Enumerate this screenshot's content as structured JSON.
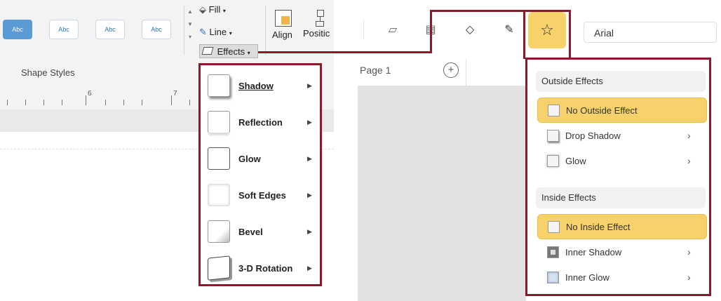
{
  "ribbon": {
    "style_buttons": [
      "Abc",
      "Abc",
      "Abc",
      "Abc"
    ],
    "fill_label": "Fill",
    "line_label": "Line",
    "effects_label": "Effects",
    "align_label": "Align",
    "position_label": "Positic",
    "group_label": "Shape Styles",
    "ruler_numbers": [
      "6",
      "7"
    ]
  },
  "effects_menu": {
    "items": [
      {
        "label": "Shadow"
      },
      {
        "label": "Reflection"
      },
      {
        "label": "Glow"
      },
      {
        "label": "Soft Edges"
      },
      {
        "label": "Bevel"
      },
      {
        "label": "3-D Rotation"
      }
    ]
  },
  "app": {
    "font_value": "Arial",
    "page_tab": "Page 1",
    "add_page_icon": "plus-circle-icon",
    "highlight_color": "#f7d26a",
    "callout_color": "#8b1a2b"
  },
  "effects_panel": {
    "outside_title": "Outside Effects",
    "outside_options": [
      {
        "label": "No Outside Effect",
        "selected": true
      },
      {
        "label": "Drop Shadow",
        "has_submenu": true
      },
      {
        "label": "Glow",
        "has_submenu": true
      }
    ],
    "inside_title": "Inside Effects",
    "inside_options": [
      {
        "label": "No Inside Effect",
        "selected": true
      },
      {
        "label": "Inner Shadow",
        "has_submenu": true
      },
      {
        "label": "Inner Glow",
        "has_submenu": true
      }
    ]
  }
}
